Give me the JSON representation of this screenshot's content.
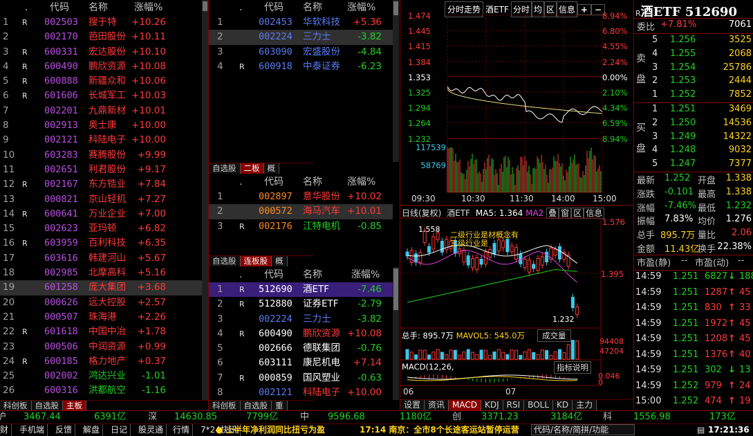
{
  "colors": {
    "up": "#ff3a3a",
    "down": "#22d022",
    "accent": "#8a0000",
    "code_purple": "#b84ee0",
    "code_blue": "#5a7cf0",
    "yellow": "#ffd21e"
  },
  "left_list": {
    "headers": {
      "dot": ".",
      "code": "代码",
      "name": "名称",
      "chg": "涨幅%"
    },
    "rows": [
      {
        "n": "1",
        "r": "R",
        "code": "002503",
        "name": "搜于特",
        "chg": "+10.26"
      },
      {
        "n": "2",
        "r": "",
        "code": "002170",
        "name": "芭田股份",
        "chg": "+10.11"
      },
      {
        "n": "3",
        "r": "R",
        "code": "600331",
        "name": "宏达股份",
        "chg": "+10.10"
      },
      {
        "n": "4",
        "r": "R",
        "code": "600490",
        "name": "鹏欣资源",
        "chg": "+10.08"
      },
      {
        "n": "5",
        "r": "R",
        "code": "600888",
        "name": "新疆众和",
        "chg": "+10.06"
      },
      {
        "n": "6",
        "r": "R",
        "code": "601606",
        "name": "长城军工",
        "chg": "+10.03"
      },
      {
        "n": "7",
        "r": "",
        "code": "002201",
        "name": "九鼎新材",
        "chg": "+10.01"
      },
      {
        "n": "8",
        "r": "",
        "code": "002913",
        "name": "奥士康",
        "chg": "+10.00"
      },
      {
        "n": "9",
        "r": "",
        "code": "002121",
        "name": "科陆电子",
        "chg": "+10.00"
      },
      {
        "n": "10",
        "r": "",
        "code": "603283",
        "name": "赛腾股份",
        "chg": "+9.99"
      },
      {
        "n": "11",
        "r": "",
        "code": "002651",
        "name": "利君股份",
        "chg": "+9.17"
      },
      {
        "n": "12",
        "r": "R",
        "code": "002167",
        "name": "东方锆业",
        "chg": "+7.84"
      },
      {
        "n": "13",
        "r": "",
        "code": "000821",
        "name": "京山轻机",
        "chg": "+7.27"
      },
      {
        "n": "14",
        "r": "R",
        "code": "600641",
        "name": "万业企业",
        "chg": "+7.00"
      },
      {
        "n": "15",
        "r": "",
        "code": "002623",
        "name": "亚玛顿",
        "chg": "+6.82"
      },
      {
        "n": "16",
        "r": "R",
        "code": "603959",
        "name": "百利科技",
        "chg": "+6.35"
      },
      {
        "n": "17",
        "r": "",
        "code": "603616",
        "name": "韩建河山",
        "chg": "+5.67"
      },
      {
        "n": "18",
        "r": "",
        "code": "002985",
        "name": "北摩高科",
        "chg": "+5.16"
      },
      {
        "n": "19",
        "r": "",
        "code": "601258",
        "name": "庞大集团",
        "chg": "+3.68"
      },
      {
        "n": "20",
        "r": "",
        "code": "000626",
        "name": "远大控股",
        "chg": "+2.57"
      },
      {
        "n": "21",
        "r": "",
        "code": "000507",
        "name": "珠海港",
        "chg": "+2.26"
      },
      {
        "n": "22",
        "r": "R",
        "code": "601618",
        "name": "中国中冶",
        "chg": "+1.78"
      },
      {
        "n": "23",
        "r": "",
        "code": "000506",
        "name": "中润资源",
        "chg": "+0.99"
      },
      {
        "n": "24",
        "r": "R",
        "code": "600185",
        "name": "格力地产",
        "chg": "+0.37"
      },
      {
        "n": "25",
        "r": "",
        "code": "002002",
        "name": "鸿达兴业",
        "chg": "-1.01"
      },
      {
        "n": "26",
        "r": "",
        "code": "600316",
        "name": "洪都航空",
        "chg": "-1.16"
      }
    ],
    "tabs": [
      "科创板",
      "自选股",
      "主板"
    ]
  },
  "mid_top": {
    "headers": {
      "dot": ".",
      "code": "代码",
      "name": "名称",
      "chg": "涨幅%"
    },
    "rows": [
      {
        "n": "1",
        "r": "",
        "code": "002453",
        "name": "华软科技",
        "chg": "+5.36"
      },
      {
        "n": "2",
        "r": "",
        "code": "002224",
        "name": "三力士",
        "chg": "-3.82"
      },
      {
        "n": "3",
        "r": "",
        "code": "603090",
        "name": "宏盛股份",
        "chg": "-4.84"
      },
      {
        "n": "4",
        "r": "R",
        "code": "600918",
        "name": "中泰证券",
        "chg": "-6.23"
      }
    ],
    "tabs": [
      "自选股",
      "二板",
      "概"
    ]
  },
  "mid_mid": {
    "headers": {
      "dot": ".",
      "code": "代码",
      "name": "名称",
      "chg": "涨幅%"
    },
    "rows": [
      {
        "n": "1",
        "r": "",
        "code": "002897",
        "name": "意华股份",
        "chg": "+10.02"
      },
      {
        "n": "2",
        "r": "",
        "code": "000572",
        "name": "海马汽车",
        "chg": "+10.01"
      },
      {
        "n": "3",
        "r": "R",
        "code": "002176",
        "name": "江特电机",
        "chg": "-0.85"
      }
    ],
    "tabs": [
      "自选股",
      "连板股",
      "概"
    ]
  },
  "mid_bot": {
    "headers": {
      "dot": ".",
      "code": "代码",
      "name": "名称",
      "chg": "涨幅%"
    },
    "rows": [
      {
        "n": "1",
        "r": "R",
        "code": "512690",
        "name": "酒ETF",
        "chg": "-7.46"
      },
      {
        "n": "2",
        "r": "R",
        "code": "512880",
        "name": "证券ETF",
        "chg": "-2.79"
      },
      {
        "n": "3",
        "r": "",
        "code": "002224",
        "name": "三力士",
        "chg": "-3.82"
      },
      {
        "n": "4",
        "r": "R",
        "code": "600490",
        "name": "鹏欣资源",
        "chg": "+10.08"
      },
      {
        "n": "5",
        "r": "",
        "code": "002666",
        "name": "德联集团",
        "chg": "-0.76"
      },
      {
        "n": "6",
        "r": "",
        "code": "603111",
        "name": "康尼机电",
        "chg": "+7.14"
      },
      {
        "n": "7",
        "r": "R",
        "code": "000859",
        "name": "国风塑业",
        "chg": "-0.63"
      },
      {
        "n": "8",
        "r": "",
        "code": "002121",
        "name": "科陆电子",
        "chg": "+10.00"
      }
    ],
    "tabs": [
      "科创板",
      "自选股",
      "重"
    ]
  },
  "intraday": {
    "tabs": [
      "分时走势",
      "酒ETF",
      "分时",
      "均",
      "区",
      "信息"
    ],
    "prices": [
      "1.474",
      "1.445",
      "1.415",
      "1.384",
      "1.353",
      "1.325",
      "1.294",
      "1.264",
      "1.232"
    ],
    "pcts": [
      "8.94%",
      "6.80%",
      "4.55%",
      "2.24%",
      "0.00%",
      "2.10%",
      "4.34%",
      "6.59%",
      "8.94%"
    ],
    "vol": [
      "117539",
      "58769"
    ],
    "times": [
      "09:30",
      "10:30",
      "11:30",
      "14:00",
      "15:00"
    ]
  },
  "daily": {
    "title": "日线(复权)",
    "name": "酒ETF",
    "ma5": "MA5: 1.364",
    "ma2": "MA2",
    "btns": [
      "叠",
      "窗",
      "区",
      "信息"
    ],
    "high": "1.558",
    "low": "1.232",
    "ax_top": "1.576",
    "ax_mid": "1.395",
    "note1": "二级行业是",
    "note2": "三级行业是",
    "note3": "材概念有",
    "vol_lbl": "总手: 895.7万",
    "mavol": "MAVOL5: 545.0万",
    "vol_btn": "成交量",
    "vol_ax1": "94408",
    "vol_ax2": "47204",
    "macd_lbl": "MACD(12,26,",
    "macd_btn": "指标说明",
    "macd_ax1": "0.046",
    "macd_ax2": "0",
    "dates": [
      "06",
      "07"
    ],
    "bottom_tabs": [
      "设置",
      "资讯",
      "MACD",
      "KDJ",
      "RSI",
      "BOLL",
      "KD",
      "主力"
    ]
  },
  "quote": {
    "title": "酒ETF 512690",
    "r": "R",
    "wb": "委比",
    "wb_val": "+7.81%",
    "wb_num": "7061",
    "sell_lbl": [
      "卖",
      "盘"
    ],
    "buy_lbl": [
      "买",
      "盘"
    ],
    "sells": [
      {
        "n": "5",
        "p": "1.256",
        "v": "3525"
      },
      {
        "n": "4",
        "p": "1.255",
        "v": "2068"
      },
      {
        "n": "3",
        "p": "1.254",
        "v": "25786"
      },
      {
        "n": "2",
        "p": "1.253",
        "v": "2444"
      },
      {
        "n": "1",
        "p": "1.252",
        "v": "7852"
      }
    ],
    "buys": [
      {
        "n": "1",
        "p": "1.251",
        "v": "3469"
      },
      {
        "n": "2",
        "p": "1.250",
        "v": "14536"
      },
      {
        "n": "3",
        "p": "1.249",
        "v": "14322"
      },
      {
        "n": "4",
        "p": "1.248",
        "v": "9032"
      },
      {
        "n": "5",
        "p": "1.247",
        "v": "7377"
      }
    ],
    "stats": [
      {
        "a": "最新",
        "av": "1.252",
        "b": "开盘",
        "bv": "1.338"
      },
      {
        "a": "涨跌",
        "av": "-0.101",
        "b": "最高",
        "bv": "1.338"
      },
      {
        "a": "涨幅",
        "av": "-7.46%",
        "b": "最低",
        "bv": "1.232"
      },
      {
        "a": "振幅",
        "av": "7.83%",
        "b": "均价",
        "bv": "1.276"
      },
      {
        "a": "总手",
        "av": "895.7万",
        "b": "量比",
        "bv": "2.06"
      },
      {
        "a": "金额",
        "av": "11.43亿",
        "b": "换手",
        "bv": "22.38%"
      }
    ],
    "shijing": "市盈(静)",
    "shijing_v": "--",
    "shidong": "市盈(动)",
    "shidong_v": "--",
    "ticks": [
      {
        "t": "14:59",
        "p": "1.251",
        "v": "6827",
        "dir": "down",
        "x": "188"
      },
      {
        "t": "14:59",
        "p": "1.251",
        "v": "1287",
        "dir": "up",
        "x": "45"
      },
      {
        "t": "14:59",
        "p": "1.251",
        "v": "830",
        "dir": "up",
        "x": "33"
      },
      {
        "t": "14:59",
        "p": "1.251",
        "v": "1972",
        "dir": "up",
        "x": "45"
      },
      {
        "t": "14:59",
        "p": "1.251",
        "v": "1208",
        "dir": "up",
        "x": "45"
      },
      {
        "t": "14:59",
        "p": "1.251",
        "v": "1376",
        "dir": "up",
        "x": "40"
      },
      {
        "t": "14:59",
        "p": "1.251",
        "v": "302",
        "dir": "down",
        "x": "13"
      },
      {
        "t": "14:59",
        "p": "1.252",
        "v": "979",
        "dir": "up",
        "x": "24"
      },
      {
        "t": "15:00",
        "p": "1.252",
        "v": "474",
        "dir": "up",
        "x": "19"
      }
    ]
  },
  "index_bar": {
    "sh_lbl": "沪",
    "sh": "3467.44",
    "sh_amt": "6391亿",
    "sz_lbl": "深",
    "sz": "14630.85",
    "sz_amt": "7799亿",
    "zx_lbl": "中",
    "zx": "9596.68",
    "zx_amt": "1180亿",
    "cy_lbl": "创",
    "cy": "3371.23",
    "cy_amt": "3184亿",
    "kc_lbl": "科",
    "kc": "1556.98",
    "kc_amt": "173亿"
  },
  "toolbar": {
    "items": [
      "财",
      "手机端",
      "反馈",
      "解盘",
      "日记",
      "股灵通",
      "行情",
      "7*24快讯"
    ],
    "news1": "上半年净利润同比扭亏为盈",
    "news2": "17:14 南京：全市8个长途客运站暂停运营",
    "search": "代码/名称/简拼/功能",
    "clock": "17:21:36"
  }
}
